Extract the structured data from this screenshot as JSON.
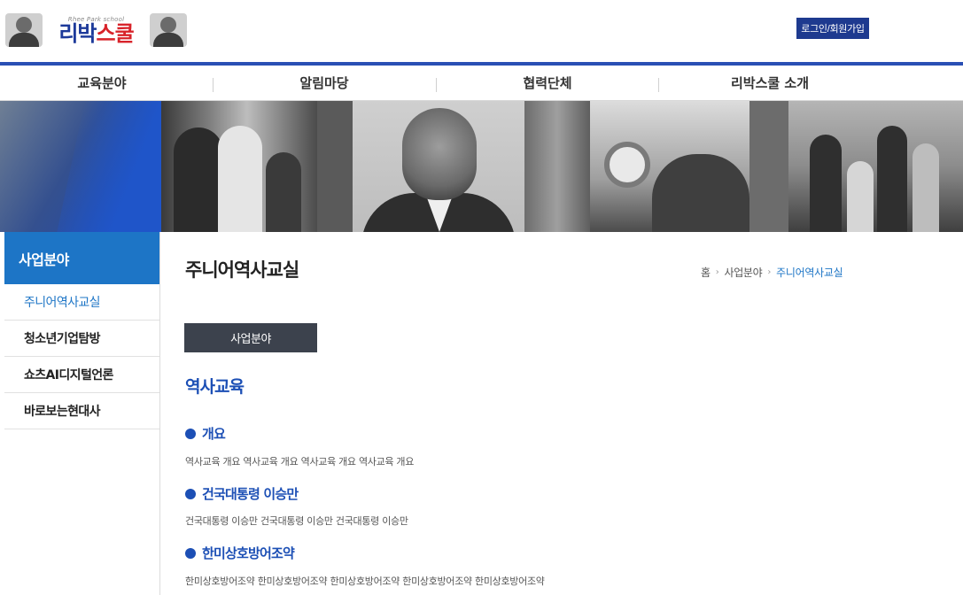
{
  "header": {
    "logo_small": "Rhee Park school",
    "logo_part1": "리박",
    "logo_part2": "스쿨",
    "login_label": "로그인/회원가입"
  },
  "nav": {
    "items": [
      {
        "label": "교육분야"
      },
      {
        "label": "알림마당"
      },
      {
        "label": "협력단체"
      },
      {
        "label": "리박스쿨 소개"
      }
    ]
  },
  "sidebar": {
    "title": "사업분야",
    "items": [
      {
        "label": "주니어역사교실",
        "active": true
      },
      {
        "label": "청소년기업탐방",
        "active": false
      },
      {
        "label": "쇼츠AI디지털언론",
        "active": false
      },
      {
        "label": "바로보는현대사",
        "active": false
      }
    ]
  },
  "main": {
    "title": "주니어역사교실",
    "breadcrumb": [
      "홈",
      "사업분야",
      "주니어역사교실"
    ],
    "tab_label": "사업분야",
    "section_title": "역사교육",
    "subsections": [
      {
        "heading": "개요",
        "text": "역사교육 개요 역사교육 개요 역사교육 개요 역사교육 개요"
      },
      {
        "heading": "건국대통령 이승만",
        "text": "건국대통령 이승만 건국대통령 이승만 건국대통령 이승만"
      },
      {
        "heading": "한미상호방어조약",
        "text": "한미상호방어조약 한미상호방어조약 한미상호방어조약 한미상호방어조약 한미상호방어조약"
      }
    ]
  },
  "colors": {
    "brand_blue": "#1d75c6",
    "nav_border": "#2a4fb4",
    "heading_blue": "#1c4fb5",
    "login_bg": "#1e3a8f",
    "tab_bg": "#3c424d"
  },
  "icons": {
    "bullet": "bullet-dot-icon",
    "breadcrumb_separator": "chevron-right-icon"
  }
}
